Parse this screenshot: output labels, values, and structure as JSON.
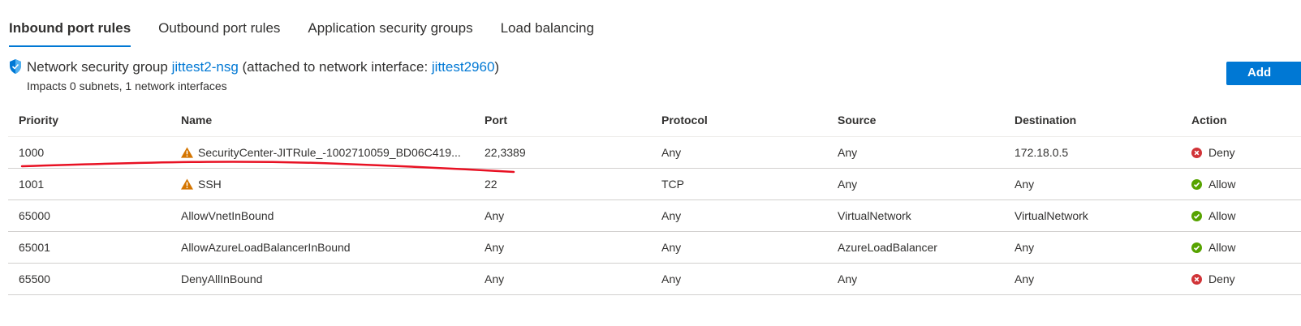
{
  "tabs": [
    {
      "label": "Inbound port rules",
      "active": true
    },
    {
      "label": "Outbound port rules",
      "active": false
    },
    {
      "label": "Application security groups",
      "active": false
    },
    {
      "label": "Load balancing",
      "active": false
    }
  ],
  "nsg": {
    "prefix": "Network security group ",
    "name": "jittest2-nsg",
    "middle": " (attached to network interface: ",
    "nic": "jittest2960",
    "suffix": ")",
    "impacts": "Impacts 0 subnets, 1 network interfaces"
  },
  "add_button_label": "Add",
  "table": {
    "columns": [
      "Priority",
      "Name",
      "Port",
      "Protocol",
      "Source",
      "Destination",
      "Action"
    ],
    "rows": [
      {
        "priority": "1000",
        "name": "SecurityCenter-JITRule_-1002710059_BD06C419...",
        "warning": true,
        "port": "22,3389",
        "protocol": "Any",
        "source": "Any",
        "destination": "172.18.0.5",
        "action": "Deny"
      },
      {
        "priority": "1001",
        "name": "SSH",
        "warning": true,
        "port": "22",
        "protocol": "TCP",
        "source": "Any",
        "destination": "Any",
        "action": "Allow"
      },
      {
        "priority": "65000",
        "name": "AllowVnetInBound",
        "warning": false,
        "port": "Any",
        "protocol": "Any",
        "source": "VirtualNetwork",
        "destination": "VirtualNetwork",
        "action": "Allow"
      },
      {
        "priority": "65001",
        "name": "AllowAzureLoadBalancerInBound",
        "warning": false,
        "port": "Any",
        "protocol": "Any",
        "source": "AzureLoadBalancer",
        "destination": "Any",
        "action": "Allow"
      },
      {
        "priority": "65500",
        "name": "DenyAllInBound",
        "warning": false,
        "port": "Any",
        "protocol": "Any",
        "source": "Any",
        "destination": "Any",
        "action": "Deny"
      }
    ]
  },
  "icons": {
    "shield": "shield-icon",
    "warning": "warning-icon",
    "deny": "deny-icon",
    "allow": "allow-icon"
  },
  "colors": {
    "accent": "#0078d4",
    "warning": "#d47500",
    "deny": "#d13438",
    "allow": "#57a300",
    "annotation": "#e81123"
  }
}
